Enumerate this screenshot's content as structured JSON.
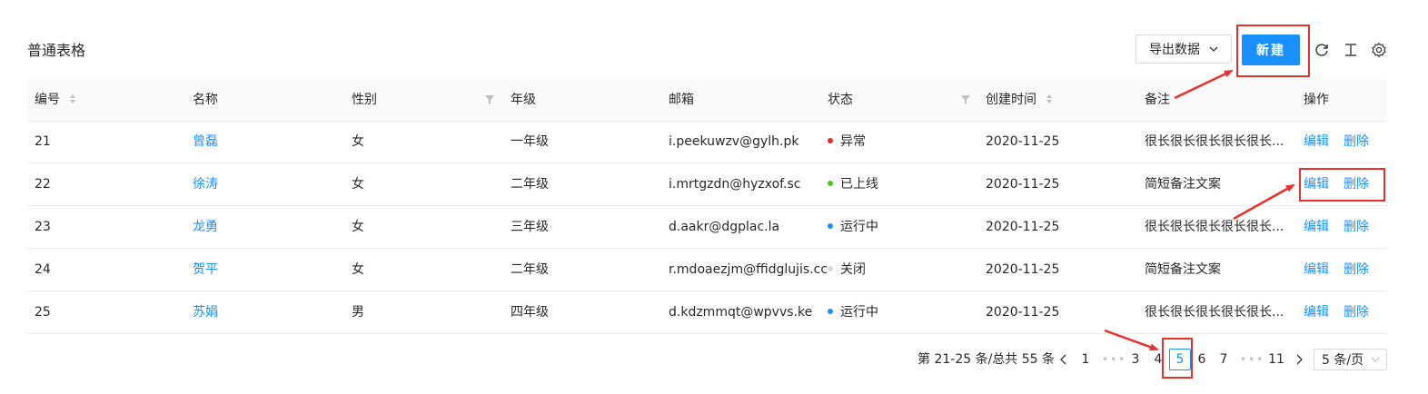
{
  "page": {
    "title": "普通表格"
  },
  "toolbar": {
    "export_label": "导出数据",
    "new_label": "新建",
    "icons": [
      "reload-icon",
      "column-height-icon",
      "settings-icon"
    ]
  },
  "table": {
    "columns": [
      "编号",
      "名称",
      "性别",
      "年级",
      "邮箱",
      "状态",
      "创建时间",
      "备注",
      "操作"
    ],
    "rows": [
      {
        "id": "21",
        "name": "曾磊",
        "gender": "女",
        "grade": "一年级",
        "email": "i.peekuwzv@gylh.pk",
        "status": "异常",
        "status_color": "#f5222d",
        "created": "2020-11-25",
        "note": "很长很长很长很长很长...",
        "edit": "编辑",
        "delete": "删除"
      },
      {
        "id": "22",
        "name": "徐涛",
        "gender": "女",
        "grade": "二年级",
        "email": "i.mrtgzdn@hyzxof.sc",
        "status": "已上线",
        "status_color": "#52c41a",
        "created": "2020-11-25",
        "note": "简短备注文案",
        "edit": "编辑",
        "delete": "删除"
      },
      {
        "id": "23",
        "name": "龙勇",
        "gender": "女",
        "grade": "三年级",
        "email": "d.aakr@dgplac.la",
        "status": "运行中",
        "status_color": "#1890ff",
        "created": "2020-11-25",
        "note": "很长很长很长很长很长...",
        "edit": "编辑",
        "delete": "删除"
      },
      {
        "id": "24",
        "name": "贺平",
        "gender": "女",
        "grade": "二年级",
        "email": "r.mdoaezjm@ffidglujis.cc",
        "status": "关闭",
        "status_color": "#d9d9d9",
        "created": "2020-11-25",
        "note": "简短备注文案",
        "edit": "编辑",
        "delete": "删除"
      },
      {
        "id": "25",
        "name": "苏娟",
        "gender": "男",
        "grade": "四年级",
        "email": "d.kdzmmqt@wpvvs.ke",
        "status": "运行中",
        "status_color": "#1890ff",
        "created": "2020-11-25",
        "note": "很长很长很长很长很长...",
        "edit": "编辑",
        "delete": "删除"
      }
    ]
  },
  "pagination": {
    "summary": "第 21-25 条/总共 55 条",
    "pages": [
      "1",
      "3",
      "4",
      "5",
      "6",
      "7",
      "11"
    ],
    "current": "5",
    "ellipsis": "•••",
    "page_size": "5 条/页"
  },
  "colors": {
    "primary": "#1890ff",
    "annotation": "#e8302c"
  }
}
